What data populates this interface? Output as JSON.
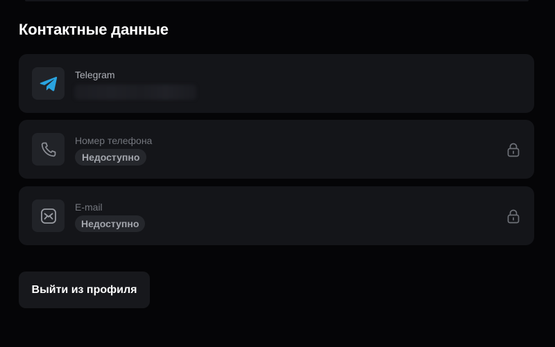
{
  "section": {
    "title": "Контактные данные"
  },
  "contacts": {
    "telegram": {
      "label": "Telegram",
      "icon": "telegram-icon",
      "value": "",
      "accent": "#2aa4e0"
    },
    "phone": {
      "label": "Номер телефона",
      "icon": "phone-icon",
      "status": "Недоступно",
      "lock_icon": "lock-icon"
    },
    "email": {
      "label": "E-mail",
      "icon": "mail-icon",
      "status": "Недоступно",
      "lock_icon": "lock-icon"
    }
  },
  "actions": {
    "logout_label": "Выйти из профиля"
  },
  "colors": {
    "background": "#050507",
    "card": "#141519",
    "icon_box": "#212328",
    "badge": "#25272c",
    "muted_text": "#73767d"
  }
}
